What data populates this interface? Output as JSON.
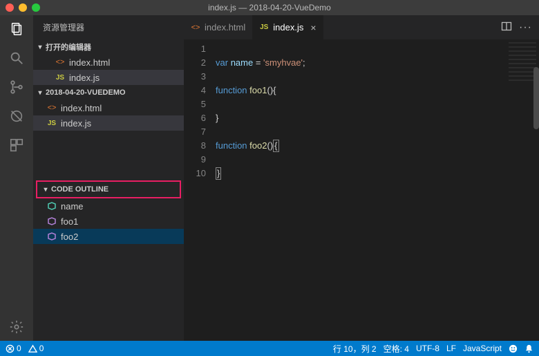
{
  "window": {
    "title": "index.js — 2018-04-20-VueDemo"
  },
  "sidebar": {
    "title": "资源管理器",
    "open_editors_label": "打开的编辑器",
    "folder_label": "2018-04-20-VUEDEMO",
    "open_editors": [
      {
        "name": "index.html",
        "icon": "<>"
      },
      {
        "name": "index.js",
        "icon": "JS"
      }
    ],
    "files": [
      {
        "name": "index.html",
        "icon": "<>"
      },
      {
        "name": "index.js",
        "icon": "JS"
      }
    ],
    "outline_label": "CODE OUTLINE",
    "outline": [
      {
        "name": "name",
        "kind": "var"
      },
      {
        "name": "foo1",
        "kind": "fn"
      },
      {
        "name": "foo2",
        "kind": "fn"
      }
    ]
  },
  "tabs": [
    {
      "label": "index.html",
      "icon": "<>",
      "active": false
    },
    {
      "label": "index.js",
      "icon": "JS",
      "active": true
    }
  ],
  "editor_lines": [
    "1",
    "2",
    "3",
    "4",
    "5",
    "6",
    "7",
    "8",
    "9",
    "10"
  ],
  "code": {
    "var": "var",
    "name": "name",
    "eq": " = ",
    "str": "'smyhvae'",
    "semi": ";",
    "fn": "function",
    "foo1": "foo1",
    "foo2": "foo2",
    "paren_open": "()",
    "brace_open": "{",
    "brace_close": "}",
    "paren_only_open": "(",
    "paren_only_close": ")"
  },
  "status": {
    "errors": "0",
    "warnings": "0",
    "ln_col": "行 10，列 2",
    "spaces": "空格: 4",
    "encoding": "UTF-8",
    "eol": "LF",
    "lang": "JavaScript"
  }
}
